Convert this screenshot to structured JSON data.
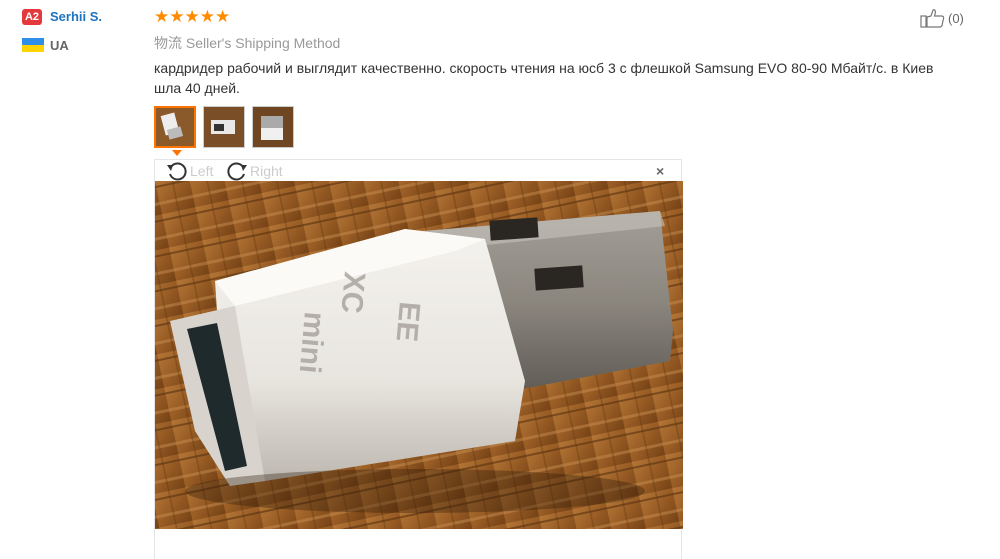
{
  "reviewer": {
    "level_badge": "A2",
    "name": "Serhii S.",
    "country": "UA"
  },
  "rating": {
    "stars": 5,
    "max": 5
  },
  "shipping": {
    "label": "物流 Seller's Shipping Method"
  },
  "review": {
    "text": "кардридер рабочий и выглядит качественно. скорость чтения на юсб 3 с флешкой Samsung EVO 80-90 Мбайт/с. в Киев шла 40 дней."
  },
  "helpful": {
    "count": "(0)"
  },
  "thumbnails": {
    "count": 3,
    "active_index": 0
  },
  "viewer": {
    "rotate_left": "Left",
    "rotate_right": "Right",
    "close": "×"
  },
  "colors": {
    "accent": "#ff7300",
    "link": "#1e73be",
    "star": "#ff8c00",
    "badge": "#e4393c"
  },
  "icons": {
    "thumbs_up": "thumbs-up-icon",
    "rotate_left": "rotate-left-icon",
    "rotate_right": "rotate-right-icon",
    "close": "close-icon"
  }
}
